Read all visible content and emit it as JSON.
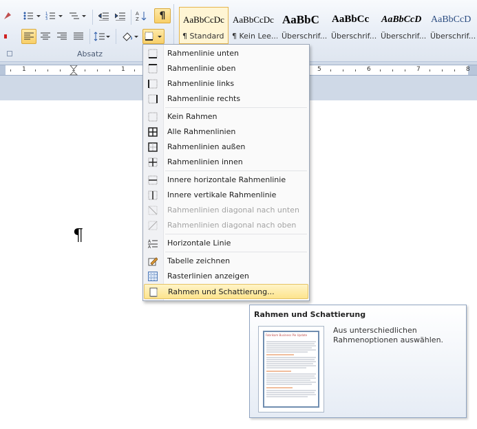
{
  "ribbon": {
    "group_label": "Absatz",
    "pilcrow_button": "¶",
    "styles": [
      {
        "preview": "AaBbCcDc",
        "name": "¶ Standard"
      },
      {
        "preview": "AaBbCcDc",
        "name": "¶ Kein Lee..."
      },
      {
        "preview": "AaBbC",
        "name": "Überschrif..."
      },
      {
        "preview": "AaBbCc",
        "name": "Überschrif..."
      },
      {
        "preview": "AaBbCcD",
        "name": "Überschrif..."
      },
      {
        "preview": "AaBbCcD",
        "name": "Überschrif..."
      }
    ]
  },
  "ruler": {
    "numbers": [
      "1",
      "1",
      "1",
      "5",
      "6",
      "7",
      "8"
    ]
  },
  "document": {
    "pilcrow": "¶"
  },
  "menu": {
    "items": [
      {
        "label": "Rahmenlinie unten",
        "icon": "border-bottom-icon",
        "disabled": false
      },
      {
        "label": "Rahmenlinie oben",
        "icon": "border-top-icon",
        "disabled": false
      },
      {
        "label": "Rahmenlinie links",
        "icon": "border-left-icon",
        "disabled": false
      },
      {
        "label": "Rahmenlinie rechts",
        "icon": "border-right-icon",
        "disabled": false
      },
      {
        "label": "Kein Rahmen",
        "icon": "no-border-icon",
        "disabled": false
      },
      {
        "label": "Alle Rahmenlinien",
        "icon": "all-borders-icon",
        "disabled": false
      },
      {
        "label": "Rahmenlinien außen",
        "icon": "outside-borders-icon",
        "disabled": false
      },
      {
        "label": "Rahmenlinien innen",
        "icon": "inside-borders-icon",
        "disabled": false
      },
      {
        "label": "Innere horizontale Rahmenlinie",
        "icon": "inside-horizontal-border-icon",
        "disabled": false
      },
      {
        "label": "Innere vertikale Rahmenlinie",
        "icon": "inside-vertical-border-icon",
        "disabled": false
      },
      {
        "label": "Rahmenlinien diagonal nach unten",
        "icon": "diagonal-down-border-icon",
        "disabled": true
      },
      {
        "label": "Rahmenlinien diagonal nach oben",
        "icon": "diagonal-up-border-icon",
        "disabled": true
      },
      {
        "label": "Horizontale Linie",
        "icon": "horizontal-line-icon",
        "disabled": false
      },
      {
        "label": "Tabelle zeichnen",
        "icon": "draw-table-icon",
        "disabled": false
      },
      {
        "label": "Rasterlinien anzeigen",
        "icon": "gridlines-icon",
        "disabled": false
      },
      {
        "label": "Rahmen und Schattierung...",
        "icon": "borders-shading-icon",
        "disabled": false
      }
    ]
  },
  "tooltip": {
    "title": "Rahmen und Schattierung",
    "description": "Aus unterschiedlichen Rahmenoptionen auswählen.",
    "preview_heading": "Fabrikam Business Pie Update"
  },
  "colors": {
    "accent_hover": "#fde48d",
    "ribbon_bg": "#e6ecf5",
    "selected_border": "#e4b44d"
  }
}
